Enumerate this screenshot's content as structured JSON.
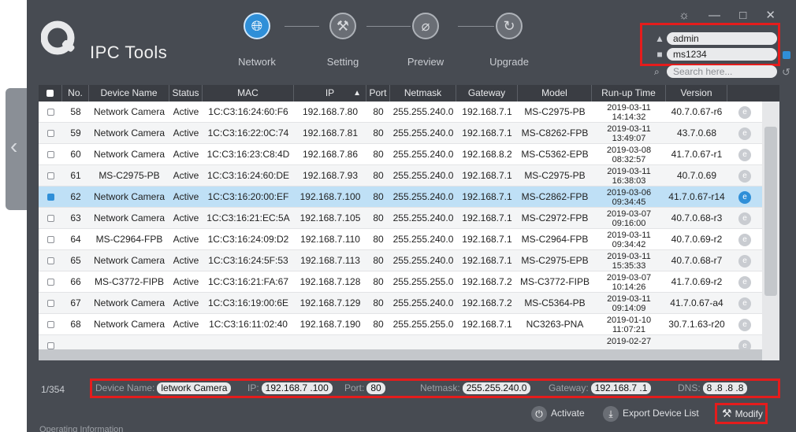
{
  "app": {
    "title": "IPC Tools",
    "window_controls": "☼ — □ ✕"
  },
  "nav": [
    {
      "label": "Network",
      "icon": "globe-icon",
      "active": true
    },
    {
      "label": "Setting",
      "icon": "tools-icon",
      "active": false
    },
    {
      "label": "Preview",
      "icon": "preview-icon",
      "active": false
    },
    {
      "label": "Upgrade",
      "icon": "upgrade-icon",
      "active": false
    }
  ],
  "credentials": {
    "username": "admin",
    "password": "ms1234",
    "search_placeholder": "Search here..."
  },
  "table": {
    "columns": [
      "",
      "No.",
      "Device Name",
      "Status",
      "MAC",
      "IP",
      "Port",
      "Netmask",
      "Gateway",
      "Model",
      "Run-up Time",
      "Version"
    ],
    "rows": [
      {
        "no": "58",
        "name": "Network Camera",
        "status": "Active",
        "mac": "1C:C3:16:24:60:F6",
        "ip": "192.168.7.80",
        "port": "80",
        "netmask": "255.255.240.0",
        "gateway": "192.168.7.1",
        "model": "MS-C2975-PB",
        "date": "2019-03-11",
        "time": "14:14:32",
        "version": "40.7.0.67-r6"
      },
      {
        "no": "59",
        "name": "Network Camera",
        "status": "Active",
        "mac": "1C:C3:16:22:0C:74",
        "ip": "192.168.7.81",
        "port": "80",
        "netmask": "255.255.240.0",
        "gateway": "192.168.7.1",
        "model": "MS-C8262-FPB",
        "date": "2019-03-11",
        "time": "13:49:07",
        "version": "43.7.0.68"
      },
      {
        "no": "60",
        "name": "Network Camera",
        "status": "Active",
        "mac": "1C:C3:16:23:C8:4D",
        "ip": "192.168.7.86",
        "port": "80",
        "netmask": "255.255.240.0",
        "gateway": "192.168.8.2",
        "model": "MS-C5362-EPB",
        "date": "2019-03-08",
        "time": "08:32:57",
        "version": "41.7.0.67-r1"
      },
      {
        "no": "61",
        "name": "MS-C2975-PB",
        "status": "Active",
        "mac": "1C:C3:16:24:60:DE",
        "ip": "192.168.7.93",
        "port": "80",
        "netmask": "255.255.240.0",
        "gateway": "192.168.7.1",
        "model": "MS-C2975-PB",
        "date": "2019-03-11",
        "time": "16:38:03",
        "version": "40.7.0.69"
      },
      {
        "no": "62",
        "name": "Network Camera",
        "status": "Active",
        "mac": "1C:C3:16:20:00:EF",
        "ip": "192.168.7.100",
        "port": "80",
        "netmask": "255.255.240.0",
        "gateway": "192.168.7.1",
        "model": "MS-C2862-FPB",
        "date": "2019-03-06",
        "time": "09:34:45",
        "version": "41.7.0.67-r14"
      },
      {
        "no": "63",
        "name": "Network Camera",
        "status": "Active",
        "mac": "1C:C3:16:21:EC:5A",
        "ip": "192.168.7.105",
        "port": "80",
        "netmask": "255.255.240.0",
        "gateway": "192.168.7.1",
        "model": "MS-C2972-FPB",
        "date": "2019-03-07",
        "time": "09:16:00",
        "version": "40.7.0.68-r3"
      },
      {
        "no": "64",
        "name": "MS-C2964-FPB",
        "status": "Active",
        "mac": "1C:C3:16:24:09:D2",
        "ip": "192.168.7.110",
        "port": "80",
        "netmask": "255.255.240.0",
        "gateway": "192.168.7.1",
        "model": "MS-C2964-FPB",
        "date": "2019-03-11",
        "time": "09:34:42",
        "version": "40.7.0.69-r2"
      },
      {
        "no": "65",
        "name": "Network Camera",
        "status": "Active",
        "mac": "1C:C3:16:24:5F:53",
        "ip": "192.168.7.113",
        "port": "80",
        "netmask": "255.255.240.0",
        "gateway": "192.168.7.1",
        "model": "MS-C2975-EPB",
        "date": "2019-03-11",
        "time": "15:35:33",
        "version": "40.7.0.68-r7"
      },
      {
        "no": "66",
        "name": "MS-C3772-FIPB",
        "status": "Active",
        "mac": "1C:C3:16:21:FA:67",
        "ip": "192.168.7.128",
        "port": "80",
        "netmask": "255.255.255.0",
        "gateway": "192.168.7.2",
        "model": "MS-C3772-FIPB",
        "date": "2019-03-07",
        "time": "10:14:26",
        "version": "41.7.0.69-r2"
      },
      {
        "no": "67",
        "name": "Network Camera",
        "status": "Active",
        "mac": "1C:C3:16:19:00:6E",
        "ip": "192.168.7.129",
        "port": "80",
        "netmask": "255.255.240.0",
        "gateway": "192.168.7.2",
        "model": "MS-C5364-PB",
        "date": "2019-03-11",
        "time": "09:14:09",
        "version": "41.7.0.67-a4"
      },
      {
        "no": "68",
        "name": "Network Camera",
        "status": "Active",
        "mac": "1C:C3:16:11:02:40",
        "ip": "192.168.7.190",
        "port": "80",
        "netmask": "255.255.255.0",
        "gateway": "192.168.7.1",
        "model": "NC3263-PNA",
        "date": "2019-01-10",
        "time": "11:07:21",
        "version": "30.7.1.63-r20"
      },
      {
        "no": "",
        "name": "",
        "status": "",
        "mac": "",
        "ip": "",
        "port": "",
        "netmask": "",
        "gateway": "",
        "model": "",
        "date": "2019-02-27",
        "time": "",
        "version": ""
      }
    ]
  },
  "footer": {
    "count": "1/354",
    "device_name_label": "Device Name:",
    "device_name": "letwork Camera",
    "ip_label": "IP:",
    "ip": "192.168.7 .100",
    "port_label": "Port:",
    "port": "80",
    "netmask_label": "Netmask:",
    "netmask": "255.255.240.0",
    "gateway_label": "Gateway:",
    "gateway": "192.168.7 .1",
    "dns_label": "DNS:",
    "dns": "8 .8 .8 .8",
    "activate": "Activate",
    "export": "Export Device List",
    "modify": "Modify",
    "operating_info": "Operating Information"
  },
  "colors": {
    "accent": "#2f8fd8",
    "highlight_box": "#e51c1c",
    "window_bg": "#474b52",
    "selected_row": "#bfe0f6"
  }
}
